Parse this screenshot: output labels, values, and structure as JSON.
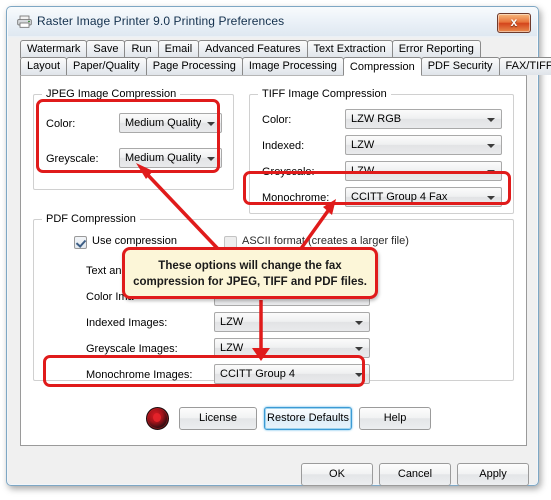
{
  "window": {
    "title": "Raster Image Printer 9.0 Printing Preferences",
    "icon": "printer-icon",
    "close_label": "x"
  },
  "tabs": {
    "row1": [
      {
        "label": "Watermark",
        "selected": false
      },
      {
        "label": "Save",
        "selected": false
      },
      {
        "label": "Run",
        "selected": false
      },
      {
        "label": "Email",
        "selected": false
      },
      {
        "label": "Advanced Features",
        "selected": false
      },
      {
        "label": "Text Extraction",
        "selected": false
      },
      {
        "label": "Error Reporting",
        "selected": false
      }
    ],
    "row2": [
      {
        "label": "Layout",
        "selected": false
      },
      {
        "label": "Paper/Quality",
        "selected": false
      },
      {
        "label": "Page Processing",
        "selected": false
      },
      {
        "label": "Image Processing",
        "selected": false
      },
      {
        "label": "Compression",
        "selected": true
      },
      {
        "label": "PDF Security",
        "selected": false
      },
      {
        "label": "FAX/TIFF",
        "selected": false
      }
    ]
  },
  "jpeg_group": {
    "legend": "JPEG Image Compression",
    "fields": [
      {
        "label": "Color:",
        "value": "Medium Quality"
      },
      {
        "label": "Greyscale:",
        "value": "Medium Quality"
      }
    ]
  },
  "tiff_group": {
    "legend": "TIFF Image Compression",
    "fields": [
      {
        "label": "Color:",
        "value": "LZW RGB"
      },
      {
        "label": "Indexed:",
        "value": "LZW"
      },
      {
        "label": "Greyscale:",
        "value": "LZW"
      },
      {
        "label": "Monochrome:",
        "value": "CCITT Group 4 Fax"
      }
    ]
  },
  "pdf_group": {
    "legend": "PDF Compression",
    "use_compression": {
      "label": "Use compression",
      "checked": true
    },
    "ascii_format": {
      "label": "ASCII format (creates a larger file)",
      "checked": false
    },
    "fields": [
      {
        "label": "Text and",
        "value": ""
      },
      {
        "label": "Color Ima",
        "value": ""
      },
      {
        "label": "Indexed Images:",
        "value": "LZW"
      },
      {
        "label": "Greyscale Images:",
        "value": "LZW"
      },
      {
        "label": "Monochrome Images:",
        "value": "CCITT Group 4"
      }
    ]
  },
  "action_buttons": {
    "license": "License",
    "restore_defaults": "Restore Defaults",
    "help": "Help"
  },
  "footer_buttons": {
    "ok": "OK",
    "cancel": "Cancel",
    "apply": "Apply"
  },
  "callout": {
    "line1": "These options will change the fax",
    "line2": "compression for JPEG, TIFF and PDF files."
  },
  "colors": {
    "annotation_red": "#e01b1b",
    "callout_background": "#fcf6d8",
    "focus_blue": "#3c9ad4",
    "title_text": "#13304d"
  }
}
